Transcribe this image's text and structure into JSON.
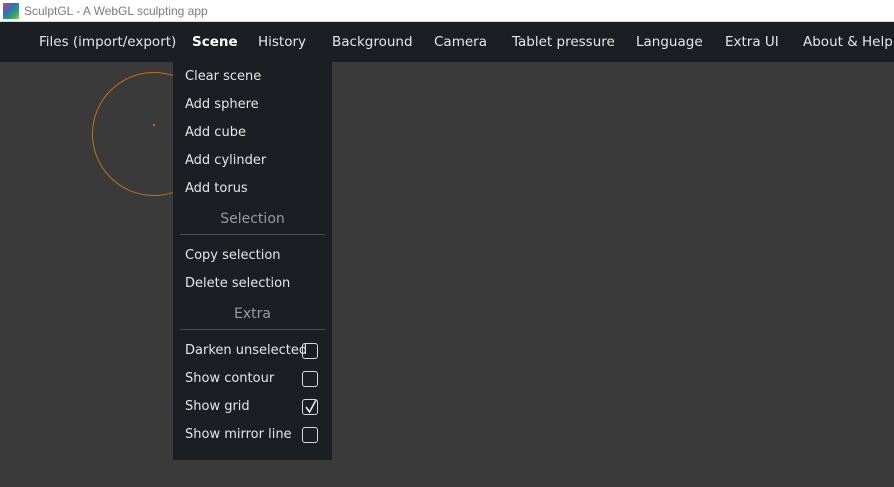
{
  "window": {
    "title": "SculptGL - A WebGL sculpting app",
    "icon": "sculptgl-app-icon"
  },
  "menubar": {
    "items": [
      {
        "label": "Files (import/export)"
      },
      {
        "label": "Scene",
        "active": true
      },
      {
        "label": "History"
      },
      {
        "label": "Background"
      },
      {
        "label": "Camera"
      },
      {
        "label": "Tablet pressure"
      },
      {
        "label": "Language"
      },
      {
        "label": "Extra UI"
      },
      {
        "label": "About & Help"
      }
    ]
  },
  "scene_menu": {
    "items": [
      {
        "label": "Clear scene"
      },
      {
        "label": "Add sphere"
      },
      {
        "label": "Add cube"
      },
      {
        "label": "Add cylinder"
      },
      {
        "label": "Add torus"
      }
    ],
    "selection_header": "Selection",
    "selection_items": [
      {
        "label": "Copy selection"
      },
      {
        "label": "Delete selection"
      }
    ],
    "extra_header": "Extra",
    "extra_items": [
      {
        "label": "Darken unselected",
        "checked": false
      },
      {
        "label": "Show contour",
        "checked": false
      },
      {
        "label": "Show grid",
        "checked": true
      },
      {
        "label": "Show mirror line",
        "checked": false
      }
    ]
  },
  "colors": {
    "menubar_bg": "#1b1e22",
    "canvas_bg": "#3a3a3a",
    "brush_circle": "#c0701a"
  }
}
